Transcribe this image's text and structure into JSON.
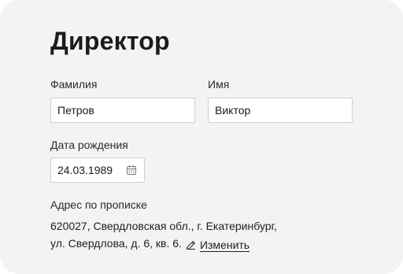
{
  "section": {
    "title": "Директор"
  },
  "form": {
    "last_name": {
      "label": "Фамилия",
      "value": "Петров"
    },
    "first_name": {
      "label": "Имя",
      "value": "Виктор"
    },
    "birth_date": {
      "label": "Дата рождения",
      "value": "24.03.1989",
      "icon": "calendar-icon"
    },
    "address": {
      "label": "Адрес по прописке",
      "line1": "620027, Свердловская обл., г. Екатеринбург,",
      "line2": "ул. Свердлова, д. 6, кв. 6.",
      "edit_icon": "pencil-icon",
      "edit_label": "Изменить"
    }
  }
}
